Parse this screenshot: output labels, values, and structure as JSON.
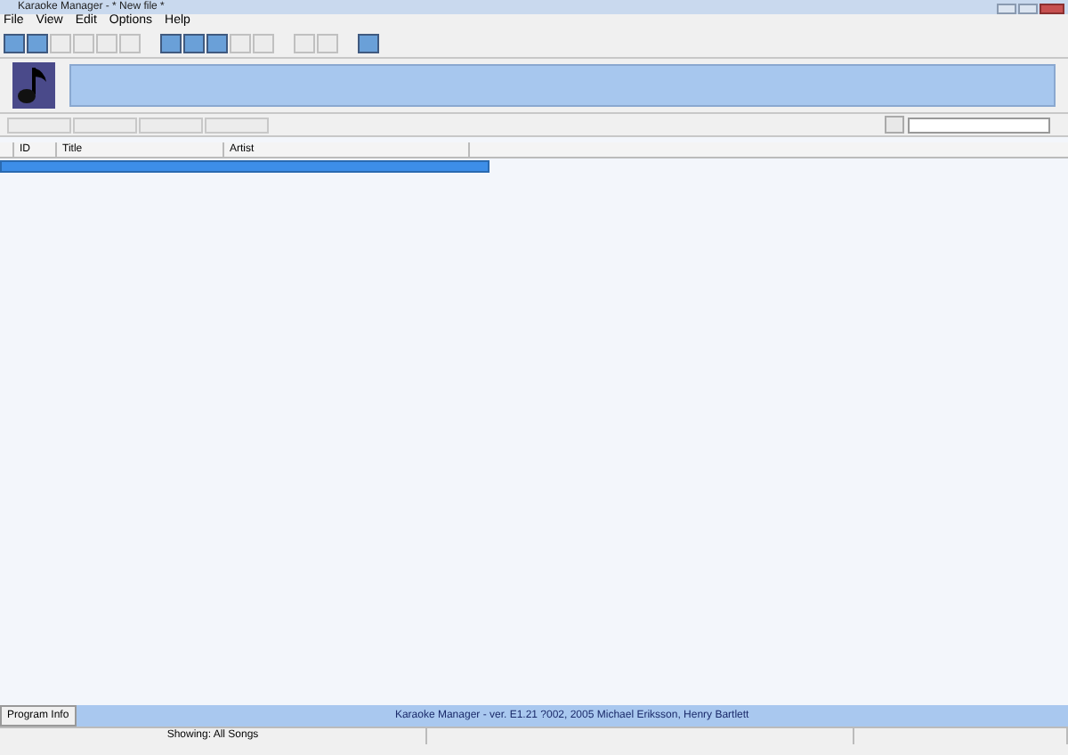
{
  "window": {
    "title": "Karaoke Manager - * New file *"
  },
  "menu": [
    "File",
    "View",
    "Edit",
    "Options",
    "Help"
  ],
  "toolbar": [
    {
      "disabled": false
    },
    {
      "disabled": false
    },
    {
      "disabled": true
    },
    {
      "disabled": true
    },
    {
      "disabled": true
    },
    {
      "disabled": true
    },
    {
      "disabled": false
    },
    {
      "disabled": false
    },
    {
      "disabled": false
    },
    {
      "disabled": true
    },
    {
      "disabled": true
    },
    {
      "disabled": true
    },
    {
      "disabled": true
    },
    {
      "disabled": false
    }
  ],
  "nav_buttons": [
    {
      "disabled": true
    },
    {
      "disabled": true
    },
    {
      "disabled": true
    },
    {
      "disabled": true
    }
  ],
  "table": {
    "columns": [
      "",
      "ID",
      "Title",
      "Artist"
    ],
    "rows": [
      {
        "selected": true
      }
    ]
  },
  "program_info_button": "Program Info",
  "credits": "Karaoke Manager - ver. E1.21 ?002, 2005 Michael Eriksson, Henry Bartlett",
  "status_bar": {
    "text": "Showing: All Songs"
  }
}
